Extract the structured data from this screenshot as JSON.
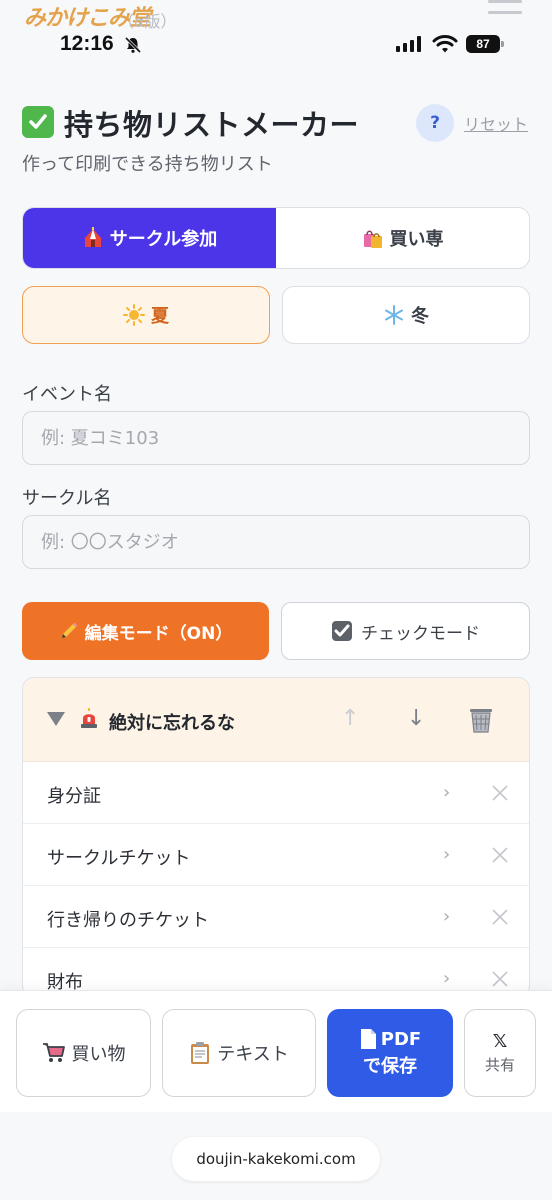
{
  "site": {
    "logo_text": "みかけこみ堂",
    "logo_alpha": "（α版）"
  },
  "status_bar": {
    "time": "12:16",
    "battery": "87"
  },
  "header": {
    "title": "持ち物リストメーカー",
    "help_label": "?",
    "reset_label": "リセット",
    "subtitle": "作って印刷できる持ち物リスト"
  },
  "participation": {
    "options": [
      {
        "label": "サークル参加",
        "icon": "circus-tent-icon",
        "active": true
      },
      {
        "label": "買い専",
        "icon": "shopping-bags-icon",
        "active": false
      }
    ]
  },
  "season": {
    "options": [
      {
        "label": "夏",
        "icon": "sun-icon",
        "active": true
      },
      {
        "label": "冬",
        "icon": "snowflake-icon",
        "active": false
      }
    ]
  },
  "form": {
    "event_label": "イベント名",
    "event_placeholder": "例: 夏コミ103",
    "event_value": "",
    "circle_label": "サークル名",
    "circle_placeholder": "例: 〇〇スタジオ",
    "circle_value": ""
  },
  "mode": {
    "edit_label": "編集モード（ON）",
    "check_label": "チェックモード"
  },
  "category": {
    "title": "絶対に忘れるな",
    "up_arrow": "↑",
    "down_arrow": "↓",
    "items": [
      {
        "label": "身分証"
      },
      {
        "label": "サークルチケット"
      },
      {
        "label": "行き帰りのチケット"
      },
      {
        "label": "財布"
      }
    ],
    "chevron": "›"
  },
  "bottom_bar": {
    "shopping_label": "買い物",
    "text_label": "テキスト",
    "pdf_line1": "PDF",
    "pdf_line2": "で保存",
    "share_x": "𝕏",
    "share_label": "共有"
  },
  "browser": {
    "url": "doujin-kakekomi.com"
  },
  "colors": {
    "accent_purple": "#4c35e8",
    "summer_orange": "#ee7326",
    "pdf_blue": "#2f5be6",
    "category_bg": "#fdf3e6"
  }
}
